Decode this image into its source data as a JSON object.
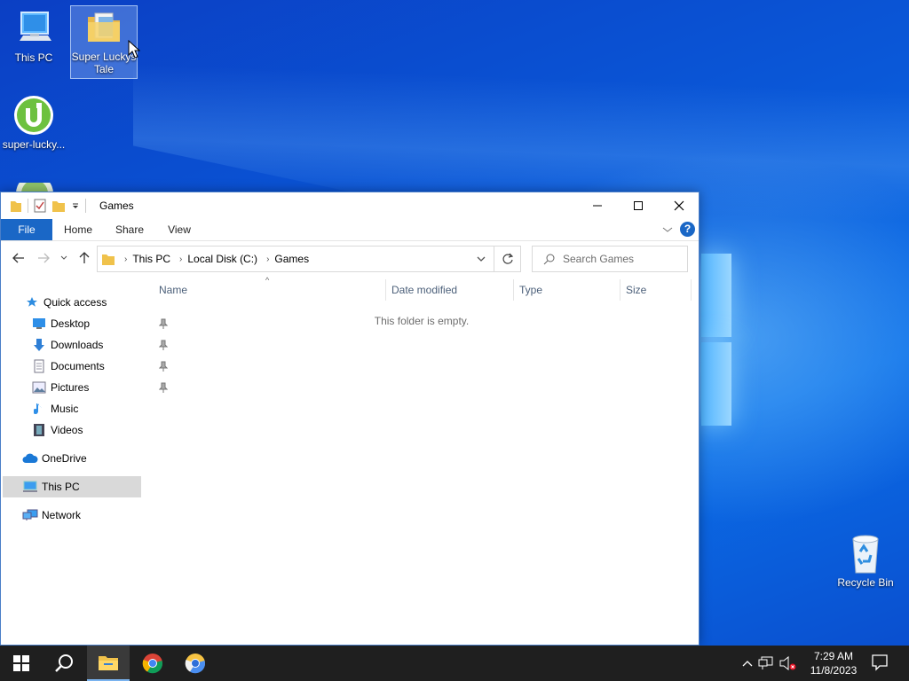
{
  "desktop": {
    "icons": [
      {
        "label": "This PC",
        "icon": "computer-icon"
      },
      {
        "label": "Super Luckys Tale",
        "icon": "folder-icon",
        "selected": true
      },
      {
        "label": "super-lucky...",
        "icon": "utorrent-icon"
      },
      {
        "label": "Recycle Bin",
        "icon": "recycle-bin-icon"
      }
    ]
  },
  "window": {
    "title": "Games",
    "ribbon_tabs": {
      "file": "File",
      "home": "Home",
      "share": "Share",
      "view": "View"
    },
    "breadcrumb": [
      "This PC",
      "Local Disk (C:)",
      "Games"
    ],
    "search_placeholder": "Search Games",
    "nav_pane": {
      "quick_access": "Quick access",
      "items": [
        {
          "label": "Desktop",
          "pinned": true
        },
        {
          "label": "Downloads",
          "pinned": true
        },
        {
          "label": "Documents",
          "pinned": true
        },
        {
          "label": "Pictures",
          "pinned": true
        },
        {
          "label": "Music",
          "pinned": false
        },
        {
          "label": "Videos",
          "pinned": false
        }
      ],
      "onedrive": "OneDrive",
      "this_pc": "This PC",
      "network": "Network"
    },
    "columns": [
      "Name",
      "Date modified",
      "Type",
      "Size"
    ],
    "empty_message": "This folder is empty."
  },
  "taskbar": {
    "apps": [
      "start-icon",
      "search-icon",
      "file-explorer-icon",
      "chrome-icon",
      "chromium-icon"
    ],
    "time": "7:29 AM",
    "date": "11/8/2023"
  },
  "colors": {
    "accent": "#1a67c6",
    "taskbar": "#1f1f1f",
    "selection": "#d9d9d9"
  }
}
